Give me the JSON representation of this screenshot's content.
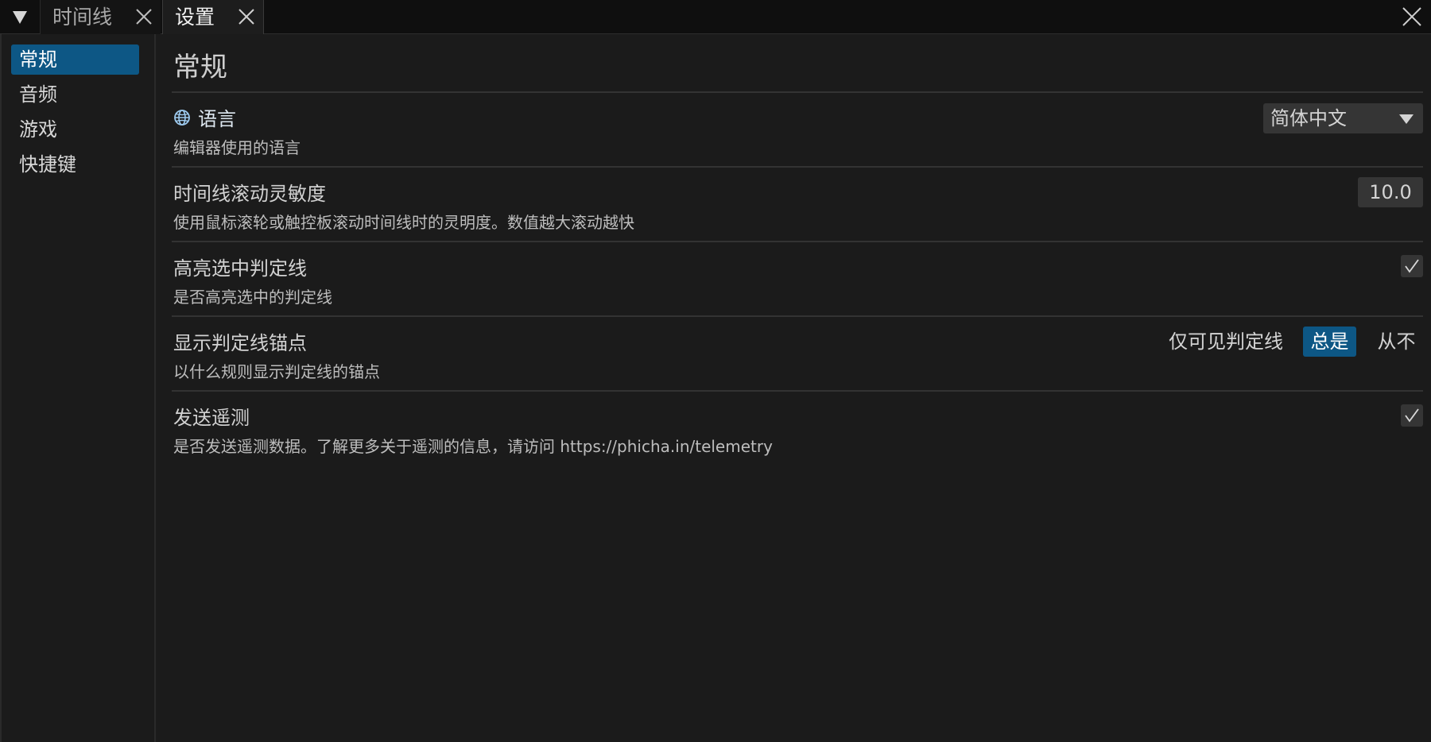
{
  "tabs": [
    {
      "label": "时间线",
      "active": false
    },
    {
      "label": "设置",
      "active": true
    }
  ],
  "sidebar": {
    "items": [
      {
        "label": "常规",
        "selected": true
      },
      {
        "label": "音频",
        "selected": false
      },
      {
        "label": "游戏",
        "selected": false
      },
      {
        "label": "快捷键",
        "selected": false
      }
    ]
  },
  "main": {
    "title": "常规",
    "settings": {
      "language": {
        "label": "语言",
        "description": "编辑器使用的语言",
        "value": "简体中文",
        "icon": "globe-icon"
      },
      "scroll_sensitivity": {
        "label": "时间线滚动灵敏度",
        "description": "使用鼠标滚轮或触控板滚动时间线时的灵明度。数值越大滚动越快",
        "value": "10.0"
      },
      "highlight_selected_line": {
        "label": "高亮选中判定线",
        "description": "是否高亮选中的判定线",
        "checked": true
      },
      "show_line_anchors": {
        "label": "显示判定线锚点",
        "description": "以什么规则显示判定线的锚点",
        "options": [
          "仅可见判定线",
          "总是",
          "从不"
        ],
        "selected": "总是"
      },
      "send_telemetry": {
        "label": "发送遥测",
        "description": "是否发送遥测数据。了解更多关于遥测的信息，请访问 https://phicha.in/telemetry",
        "checked": true
      }
    }
  },
  "colors": {
    "accent": "#0d5785",
    "background": "#1b1b1b",
    "tabbar": "#0f0f0f",
    "control": "#353535"
  }
}
